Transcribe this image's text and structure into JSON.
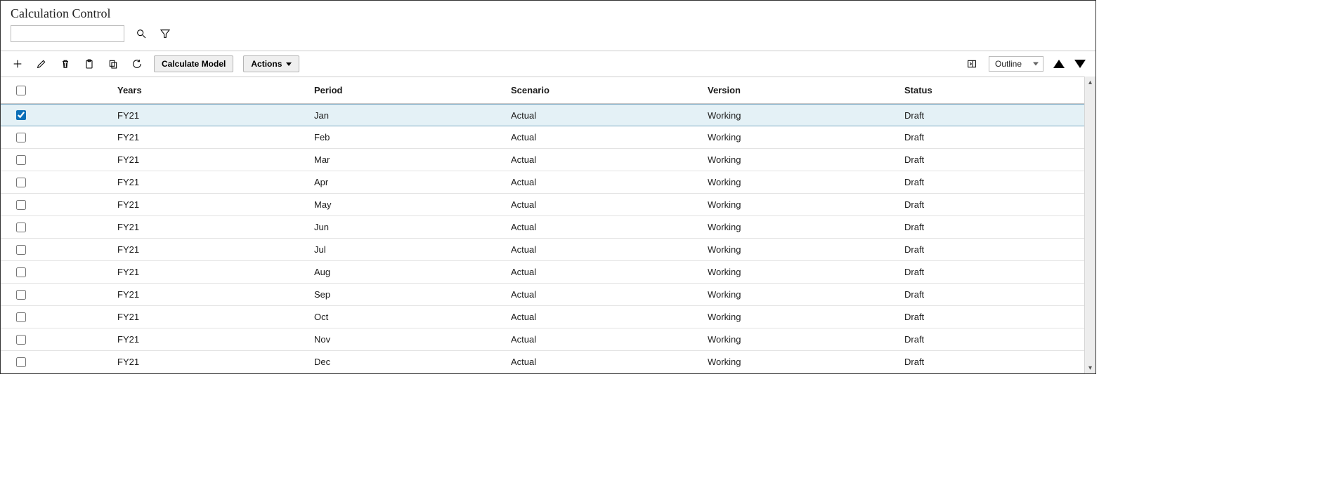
{
  "page": {
    "title": "Calculation Control"
  },
  "search": {
    "value": "",
    "placeholder": ""
  },
  "toolbar": {
    "calculate_model_label": "Calculate Model",
    "actions_label": "Actions",
    "view_mode": "Outline"
  },
  "table": {
    "columns": {
      "years": "Years",
      "period": "Period",
      "scenario": "Scenario",
      "version": "Version",
      "status": "Status"
    },
    "rows": [
      {
        "checked": true,
        "years": "FY21",
        "period": "Jan",
        "scenario": "Actual",
        "version": "Working",
        "status": "Draft"
      },
      {
        "checked": false,
        "years": "FY21",
        "period": "Feb",
        "scenario": "Actual",
        "version": "Working",
        "status": "Draft"
      },
      {
        "checked": false,
        "years": "FY21",
        "period": "Mar",
        "scenario": "Actual",
        "version": "Working",
        "status": "Draft"
      },
      {
        "checked": false,
        "years": "FY21",
        "period": "Apr",
        "scenario": "Actual",
        "version": "Working",
        "status": "Draft"
      },
      {
        "checked": false,
        "years": "FY21",
        "period": "May",
        "scenario": "Actual",
        "version": "Working",
        "status": "Draft"
      },
      {
        "checked": false,
        "years": "FY21",
        "period": "Jun",
        "scenario": "Actual",
        "version": "Working",
        "status": "Draft"
      },
      {
        "checked": false,
        "years": "FY21",
        "period": "Jul",
        "scenario": "Actual",
        "version": "Working",
        "status": "Draft"
      },
      {
        "checked": false,
        "years": "FY21",
        "period": "Aug",
        "scenario": "Actual",
        "version": "Working",
        "status": "Draft"
      },
      {
        "checked": false,
        "years": "FY21",
        "period": "Sep",
        "scenario": "Actual",
        "version": "Working",
        "status": "Draft"
      },
      {
        "checked": false,
        "years": "FY21",
        "period": "Oct",
        "scenario": "Actual",
        "version": "Working",
        "status": "Draft"
      },
      {
        "checked": false,
        "years": "FY21",
        "period": "Nov",
        "scenario": "Actual",
        "version": "Working",
        "status": "Draft"
      },
      {
        "checked": false,
        "years": "FY21",
        "period": "Dec",
        "scenario": "Actual",
        "version": "Working",
        "status": "Draft"
      }
    ]
  }
}
